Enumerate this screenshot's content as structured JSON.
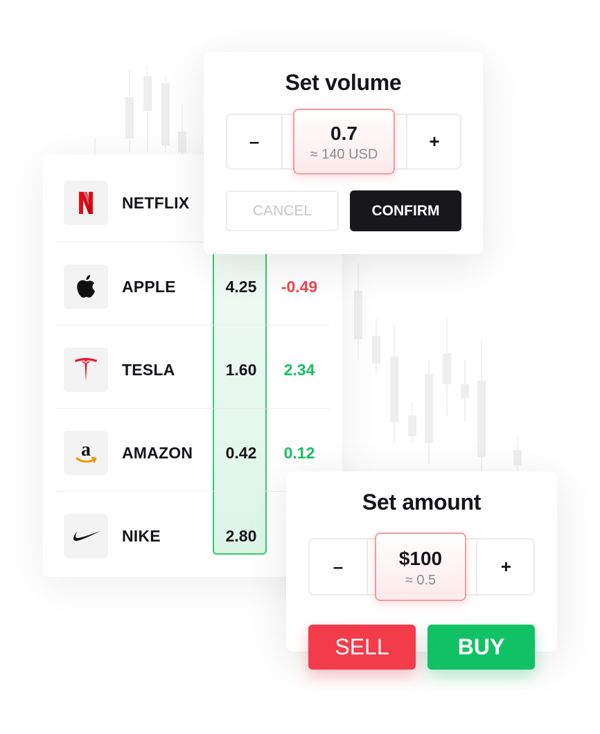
{
  "stocks": [
    {
      "name": "NETFLIX",
      "icon": "netflix-logo-icon",
      "value": "",
      "change": ""
    },
    {
      "name": "APPLE",
      "icon": "apple-logo-icon",
      "value": "4.25",
      "change": "-0.49"
    },
    {
      "name": "TESLA",
      "icon": "tesla-logo-icon",
      "value": "1.60",
      "change": "2.34"
    },
    {
      "name": "AMAZON",
      "icon": "amazon-logo-icon",
      "value": "0.42",
      "change": "0.12"
    },
    {
      "name": "NIKE",
      "icon": "nike-logo-icon",
      "value": "2.80",
      "change": ""
    }
  ],
  "volume_popup": {
    "title": "Set volume",
    "decrement": "–",
    "increment": "+",
    "value": "0.7",
    "approx": "≈ 140 USD",
    "cancel_label": "CANCEL",
    "confirm_label": "CONFIRM"
  },
  "amount_popup": {
    "title": "Set amount",
    "decrement": "–",
    "increment": "+",
    "value": "$100",
    "approx": "≈ 0.5",
    "sell_label": "SELL",
    "buy_label": "BUY"
  },
  "colors": {
    "negative": "#f04452",
    "positive": "#16c064",
    "sell": "#f23c4b",
    "buy": "#11c264",
    "confirm": "#17171c",
    "netflix": "#e50914",
    "tesla": "#e31937",
    "amazon_smile": "#f79400"
  }
}
